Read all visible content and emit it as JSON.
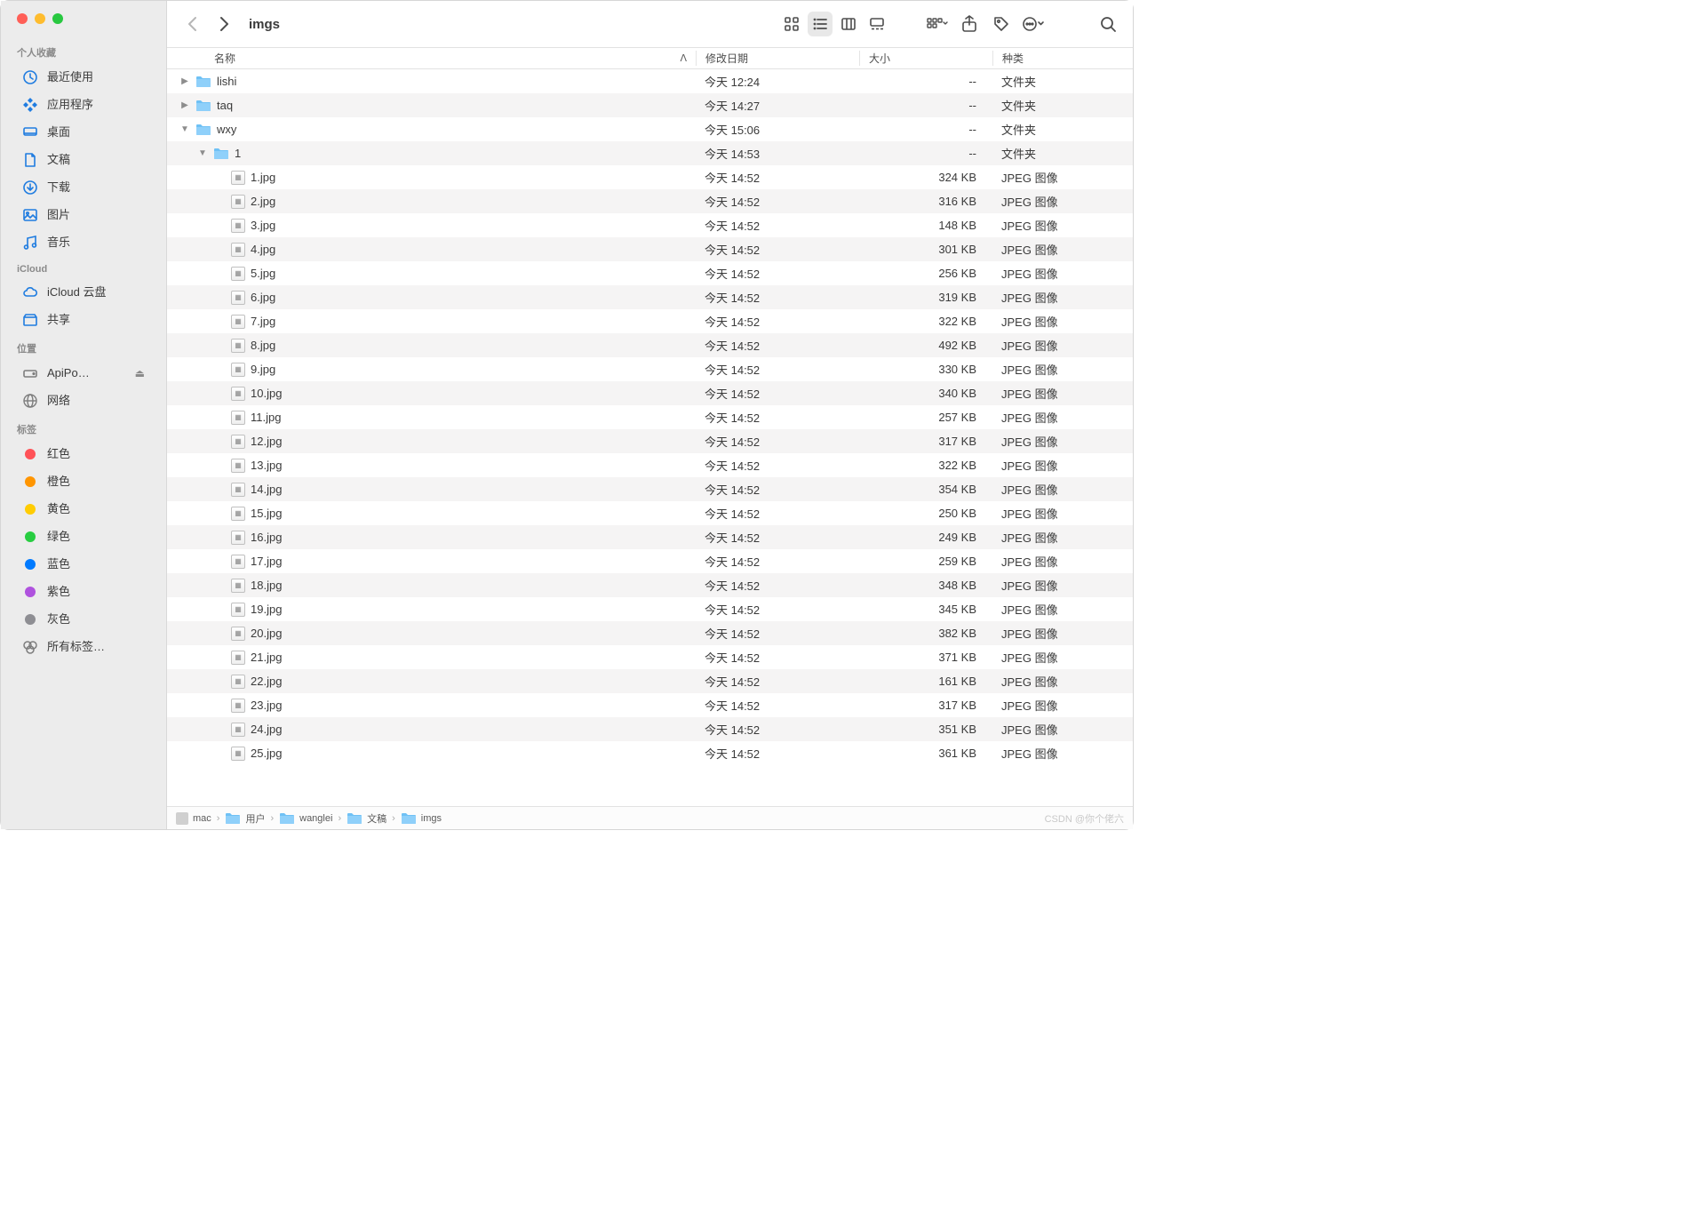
{
  "window": {
    "title": "imgs"
  },
  "sidebar": {
    "sections": [
      {
        "label": "个人收藏",
        "items": [
          {
            "icon": "clock",
            "label": "最近使用"
          },
          {
            "icon": "app",
            "label": "应用程序"
          },
          {
            "icon": "desktop",
            "label": "桌面"
          },
          {
            "icon": "doc",
            "label": "文稿"
          },
          {
            "icon": "download",
            "label": "下载"
          },
          {
            "icon": "image",
            "label": "图片"
          },
          {
            "icon": "music",
            "label": "音乐"
          }
        ]
      },
      {
        "label": "iCloud",
        "items": [
          {
            "icon": "cloud",
            "label": "iCloud 云盘"
          },
          {
            "icon": "shared",
            "label": "共享"
          }
        ]
      },
      {
        "label": "位置",
        "items": [
          {
            "icon": "disk",
            "label": "ApiPo…",
            "eject": true
          },
          {
            "icon": "globe",
            "label": "网络"
          }
        ]
      },
      {
        "label": "标签",
        "items": [
          {
            "tag": "#ff5257",
            "label": "红色"
          },
          {
            "tag": "#ff9500",
            "label": "橙色"
          },
          {
            "tag": "#ffcc02",
            "label": "黄色"
          },
          {
            "tag": "#28cd41",
            "label": "绿色"
          },
          {
            "tag": "#007aff",
            "label": "蓝色"
          },
          {
            "tag": "#af52de",
            "label": "紫色"
          },
          {
            "tag": "#8e8e93",
            "label": "灰色"
          },
          {
            "icon": "alltags",
            "label": "所有标签…"
          }
        ]
      }
    ]
  },
  "columns": {
    "name": "名称",
    "date": "修改日期",
    "size": "大小",
    "kind": "种类"
  },
  "files": [
    {
      "indent": 0,
      "disclosure": "right",
      "type": "folder",
      "name": "lishi",
      "date": "今天 12:24",
      "size": "--",
      "kind": "文件夹"
    },
    {
      "indent": 0,
      "disclosure": "right",
      "type": "folder",
      "name": "taq",
      "date": "今天 14:27",
      "size": "--",
      "kind": "文件夹"
    },
    {
      "indent": 0,
      "disclosure": "down",
      "type": "folder",
      "name": "wxy",
      "date": "今天 15:06",
      "size": "--",
      "kind": "文件夹"
    },
    {
      "indent": 1,
      "disclosure": "down",
      "type": "folder",
      "name": "1",
      "date": "今天 14:53",
      "size": "--",
      "kind": "文件夹"
    },
    {
      "indent": 2,
      "type": "file",
      "name": "1.jpg",
      "date": "今天 14:52",
      "size": "324 KB",
      "kind": "JPEG 图像"
    },
    {
      "indent": 2,
      "type": "file",
      "name": "2.jpg",
      "date": "今天 14:52",
      "size": "316 KB",
      "kind": "JPEG 图像"
    },
    {
      "indent": 2,
      "type": "file",
      "name": "3.jpg",
      "date": "今天 14:52",
      "size": "148 KB",
      "kind": "JPEG 图像"
    },
    {
      "indent": 2,
      "type": "file",
      "name": "4.jpg",
      "date": "今天 14:52",
      "size": "301 KB",
      "kind": "JPEG 图像"
    },
    {
      "indent": 2,
      "type": "file",
      "name": "5.jpg",
      "date": "今天 14:52",
      "size": "256 KB",
      "kind": "JPEG 图像"
    },
    {
      "indent": 2,
      "type": "file",
      "name": "6.jpg",
      "date": "今天 14:52",
      "size": "319 KB",
      "kind": "JPEG 图像"
    },
    {
      "indent": 2,
      "type": "file",
      "name": "7.jpg",
      "date": "今天 14:52",
      "size": "322 KB",
      "kind": "JPEG 图像"
    },
    {
      "indent": 2,
      "type": "file",
      "name": "8.jpg",
      "date": "今天 14:52",
      "size": "492 KB",
      "kind": "JPEG 图像"
    },
    {
      "indent": 2,
      "type": "file",
      "name": "9.jpg",
      "date": "今天 14:52",
      "size": "330 KB",
      "kind": "JPEG 图像"
    },
    {
      "indent": 2,
      "type": "file",
      "name": "10.jpg",
      "date": "今天 14:52",
      "size": "340 KB",
      "kind": "JPEG 图像"
    },
    {
      "indent": 2,
      "type": "file",
      "name": "11.jpg",
      "date": "今天 14:52",
      "size": "257 KB",
      "kind": "JPEG 图像"
    },
    {
      "indent": 2,
      "type": "file",
      "name": "12.jpg",
      "date": "今天 14:52",
      "size": "317 KB",
      "kind": "JPEG 图像"
    },
    {
      "indent": 2,
      "type": "file",
      "name": "13.jpg",
      "date": "今天 14:52",
      "size": "322 KB",
      "kind": "JPEG 图像"
    },
    {
      "indent": 2,
      "type": "file",
      "name": "14.jpg",
      "date": "今天 14:52",
      "size": "354 KB",
      "kind": "JPEG 图像"
    },
    {
      "indent": 2,
      "type": "file",
      "name": "15.jpg",
      "date": "今天 14:52",
      "size": "250 KB",
      "kind": "JPEG 图像"
    },
    {
      "indent": 2,
      "type": "file",
      "name": "16.jpg",
      "date": "今天 14:52",
      "size": "249 KB",
      "kind": "JPEG 图像"
    },
    {
      "indent": 2,
      "type": "file",
      "name": "17.jpg",
      "date": "今天 14:52",
      "size": "259 KB",
      "kind": "JPEG 图像"
    },
    {
      "indent": 2,
      "type": "file",
      "name": "18.jpg",
      "date": "今天 14:52",
      "size": "348 KB",
      "kind": "JPEG 图像"
    },
    {
      "indent": 2,
      "type": "file",
      "name": "19.jpg",
      "date": "今天 14:52",
      "size": "345 KB",
      "kind": "JPEG 图像"
    },
    {
      "indent": 2,
      "type": "file",
      "name": "20.jpg",
      "date": "今天 14:52",
      "size": "382 KB",
      "kind": "JPEG 图像"
    },
    {
      "indent": 2,
      "type": "file",
      "name": "21.jpg",
      "date": "今天 14:52",
      "size": "371 KB",
      "kind": "JPEG 图像"
    },
    {
      "indent": 2,
      "type": "file",
      "name": "22.jpg",
      "date": "今天 14:52",
      "size": "161 KB",
      "kind": "JPEG 图像"
    },
    {
      "indent": 2,
      "type": "file",
      "name": "23.jpg",
      "date": "今天 14:52",
      "size": "317 KB",
      "kind": "JPEG 图像"
    },
    {
      "indent": 2,
      "type": "file",
      "name": "24.jpg",
      "date": "今天 14:52",
      "size": "351 KB",
      "kind": "JPEG 图像"
    },
    {
      "indent": 2,
      "type": "file",
      "name": "25.jpg",
      "date": "今天 14:52",
      "size": "361 KB",
      "kind": "JPEG 图像"
    }
  ],
  "path": [
    "mac",
    "用户",
    "wanglei",
    "文稿",
    "imgs"
  ],
  "watermark": "CSDN @你个佬六"
}
